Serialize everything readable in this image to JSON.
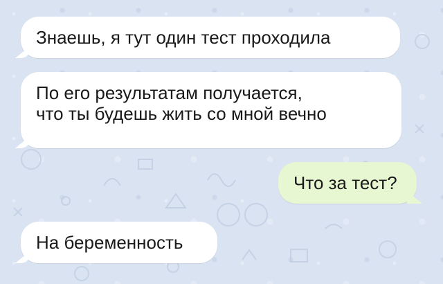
{
  "messages": [
    {
      "direction": "incoming",
      "lines": [
        "Знаешь, я тут один тест проходила"
      ]
    },
    {
      "direction": "incoming",
      "lines": [
        "По его результатам получается,",
        "что ты будешь жить со мной вечно"
      ]
    },
    {
      "direction": "outgoing",
      "lines": [
        "Что за тест?"
      ]
    },
    {
      "direction": "incoming",
      "lines": [
        "На беременность"
      ]
    }
  ],
  "colors": {
    "chat_background": "#d9e3f1",
    "incoming_bubble": "#ffffff",
    "outgoing_bubble": "#e7f7d2"
  }
}
